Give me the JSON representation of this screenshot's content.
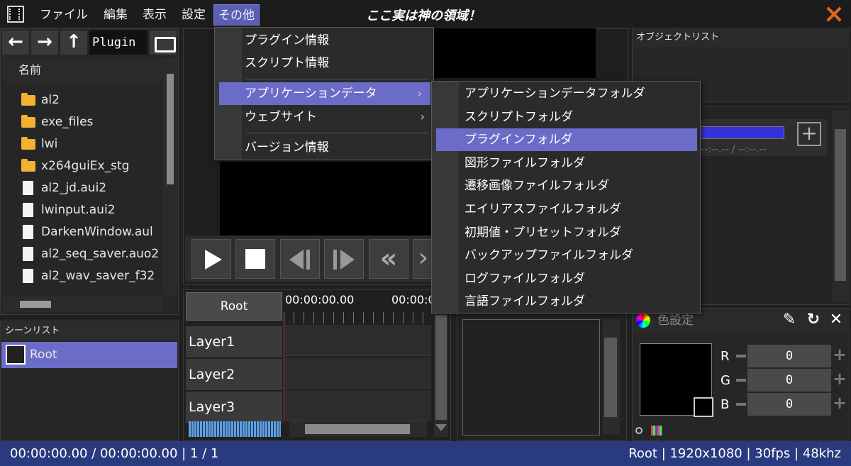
{
  "app": {
    "title": "ここ実は神の領域！"
  },
  "menubar": [
    "ファイル",
    "編集",
    "表示",
    "設定",
    "その他"
  ],
  "file_browser": {
    "path": "Plugin",
    "column_header": "名前",
    "items": [
      {
        "name": "al2",
        "type": "folder"
      },
      {
        "name": "exe_files",
        "type": "folder"
      },
      {
        "name": "lwi",
        "type": "folder"
      },
      {
        "name": "x264guiEx_stg",
        "type": "folder"
      },
      {
        "name": "al2_jd.aui2",
        "type": "file"
      },
      {
        "name": "lwinput.aui2",
        "type": "file"
      },
      {
        "name": "DarkenWindow.aul",
        "type": "file"
      },
      {
        "name": "al2_seq_saver.auo2",
        "type": "file"
      },
      {
        "name": "al2_wav_saver_f32",
        "type": "file"
      }
    ]
  },
  "scene_list": {
    "header": "シーンリスト",
    "items": [
      "Root"
    ]
  },
  "timeline": {
    "root_button": "Root",
    "time_a": "00:00:00.00",
    "time_b": "00:00:0",
    "layers": [
      "Layer1",
      "Layer2",
      "Layer3"
    ]
  },
  "object_list": {
    "header": "オブジェクトリスト"
  },
  "mid_panel": {
    "time_text": "--:--.-- / --:--.--"
  },
  "color_panel": {
    "header": "色設定",
    "channels": [
      {
        "label": "R",
        "value": "0"
      },
      {
        "label": "G",
        "value": "0"
      },
      {
        "label": "B",
        "value": "0"
      }
    ]
  },
  "status": {
    "left": "00:00:00.00 / 00:00:00.00  |  1 / 1",
    "right": "Root  |  1920x1080  |  30fps  |  48khz"
  },
  "menu_other": {
    "items": [
      "プラグイン情報",
      "スクリプト情報",
      "アプリケーションデータ",
      "ウェブサイト",
      "バージョン情報"
    ],
    "submenu_arrow": "›"
  },
  "submenu_appdata": {
    "items": [
      "アプリケーションデータフォルダ",
      "スクリプトフォルダ",
      "プラグインフォルダ",
      "図形ファイルフォルダ",
      "遷移画像ファイルフォルダ",
      "エイリアスファイルフォルダ",
      "初期値・プリセットフォルダ",
      "バックアップファイルフォルダ",
      "ログファイルフォルダ",
      "言語ファイルフォルダ"
    ],
    "highlighted": "プラグインフォルダ"
  },
  "colors": {
    "accent": "#6b6cc7",
    "statusbar": "#293a7e",
    "close": "#e8641e",
    "folder": "#f2b230"
  }
}
